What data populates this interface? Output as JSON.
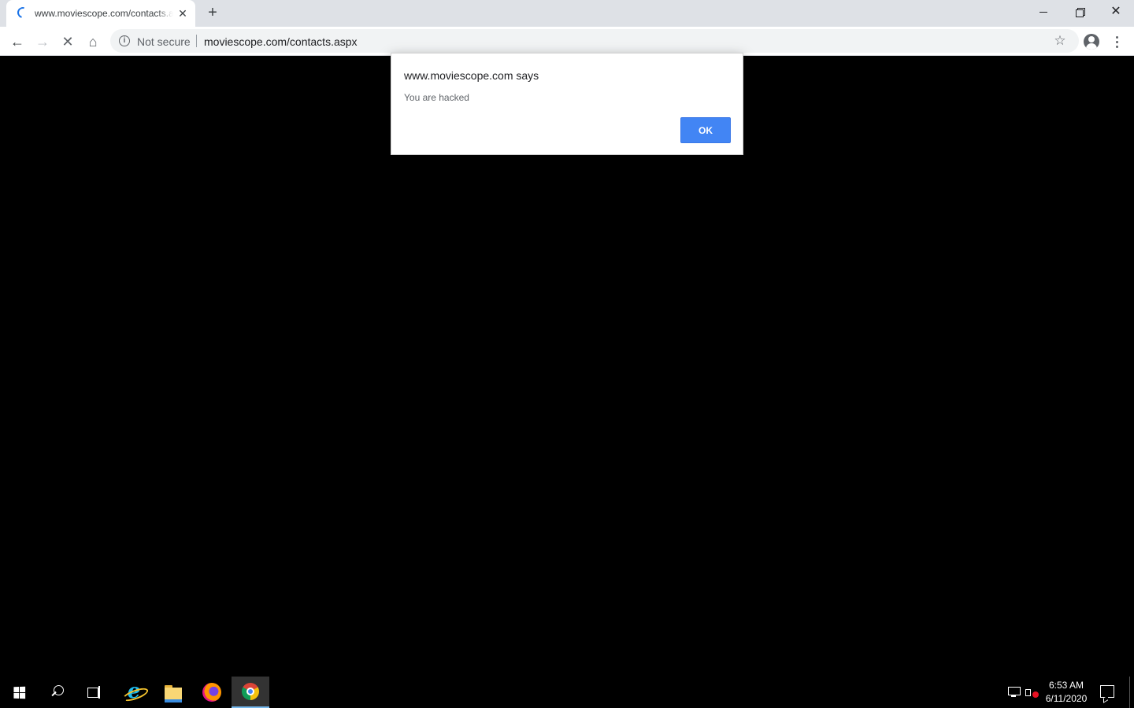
{
  "browser": {
    "tab": {
      "title": "www.moviescope.com/contacts.aspx",
      "close_glyph": "✕",
      "state": "loading"
    },
    "new_tab_glyph": "+",
    "window_controls": {
      "close_glyph": "✕"
    },
    "toolbar": {
      "back_glyph": "←",
      "forward_glyph": "→",
      "stop_glyph": "✕",
      "home_glyph": "⌂",
      "security_label": "Not secure",
      "info_glyph": "i",
      "url": "moviescope.com/contacts.aspx",
      "bookmark_glyph": "☆"
    }
  },
  "dialog": {
    "title": "www.moviescope.com says",
    "message": "You are hacked",
    "ok_label": "OK"
  },
  "taskbar": {
    "ie_glyph": "e",
    "clock_time": "6:53 AM",
    "clock_date": "6/11/2020"
  },
  "colors": {
    "accent": "#4285f4",
    "tabstrip": "#dee1e6",
    "content_background": "#000000"
  }
}
